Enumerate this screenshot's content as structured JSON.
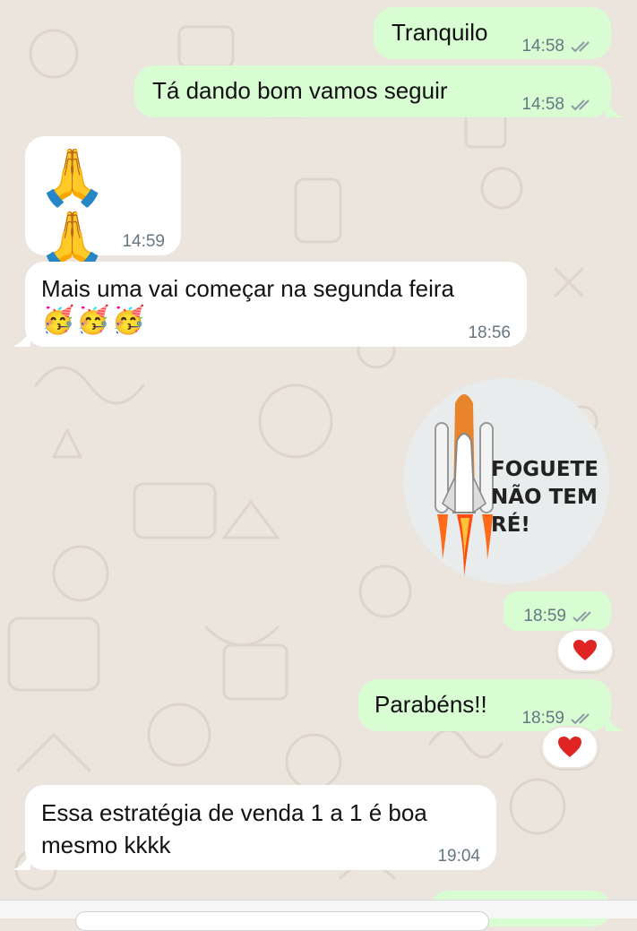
{
  "colors": {
    "outgoing_bubble": "#d9fdd3",
    "incoming_bubble": "#ffffff",
    "chat_background": "#ece5dd",
    "meta_text": "#667781",
    "heart": "#e02424"
  },
  "messages": [
    {
      "direction": "outgoing",
      "text": "Tranquilo",
      "time": "14:58",
      "status_icon": "double-check-icon"
    },
    {
      "direction": "outgoing",
      "text": "Tá dando bom vamos seguir",
      "time": "14:58",
      "status_icon": "double-check-icon"
    },
    {
      "direction": "incoming",
      "text": "🙏🙏",
      "time": "14:59"
    },
    {
      "direction": "incoming",
      "text": "Mais uma vai começar na segunda feira",
      "emoji_line": "🥳🥳🥳",
      "time": "18:56"
    },
    {
      "direction": "outgoing",
      "type": "sticker",
      "sticker_text": [
        "FOGUETE",
        "NÃO TEM",
        "RÉ!"
      ],
      "sticker_icon": "rocket-icon",
      "time": "18:59",
      "status_icon": "double-check-icon",
      "reaction": "heart-icon"
    },
    {
      "direction": "outgoing",
      "text": "Parabéns!!",
      "time": "18:59",
      "status_icon": "double-check-icon",
      "reaction": "heart-icon"
    },
    {
      "direction": "incoming",
      "text": "Essa estratégia de venda 1 a 1 é boa\nmesmo kkkk",
      "time": "19:04"
    }
  ]
}
